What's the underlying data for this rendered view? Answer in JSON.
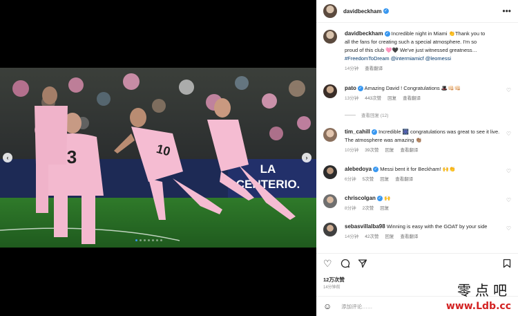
{
  "post": {
    "author": "davidbeckham",
    "caption_line1": "Incredible night in Miami 👏Thank you to",
    "caption_line2": "all the fans for creating such a special atmosphere. I'm so",
    "caption_line3": "proud of this club 🩷🖤 We've just witnessed greatness…",
    "hashtags": "#FreedomToDream @intermiamicf @leomessi",
    "caption_time": "14分钟",
    "caption_translate": "查看翻译",
    "likes": "12万次赞",
    "posted": "14分钟前",
    "comment_placeholder": "添加评论……"
  },
  "photo": {
    "jersey_numbers": [
      "3",
      "10"
    ],
    "ad_board": "LA\nCENTERIO."
  },
  "comments": [
    {
      "user": "pato",
      "text": "Amazing David ! Congratulations 🎩👊🏻👊🏻",
      "time": "13分钟",
      "likes": "443次赞",
      "reply": "回复",
      "translate": "查看翻译"
    },
    {
      "user": "tim_cahill",
      "text": "Incredible 🎆 congratulations was great to see it live. The atmosphere was amazing 👏🏽",
      "time": "10分钟",
      "likes": "39次赞",
      "reply": "回复",
      "translate": "查看翻译"
    },
    {
      "user": "alebedoya",
      "text": "Messi bent it for Beckham! 🙌👏",
      "time": "6分钟",
      "likes": "5次赞",
      "reply": "回复",
      "translate": "查看翻译"
    },
    {
      "user": "chriscolgan",
      "text": "🙌",
      "time": "8分钟",
      "likes": "2次赞",
      "reply": "回复",
      "translate": ""
    },
    {
      "user": "sebasvillalba98",
      "text": "Winning is easy with the GOAT by your side",
      "time": "14分钟",
      "likes": "42次赞",
      "reply": "回复",
      "translate": "查看翻译"
    }
  ],
  "view_replies": "查看回复 (12)",
  "icons": {
    "heart": "heart-icon",
    "comment": "comment-icon",
    "share": "share-icon",
    "save": "bookmark-icon",
    "emoji": "emoji-icon",
    "more": "more-icon"
  },
  "watermark": {
    "cn": "零点吧",
    "url": "www.Ldb.cc"
  }
}
